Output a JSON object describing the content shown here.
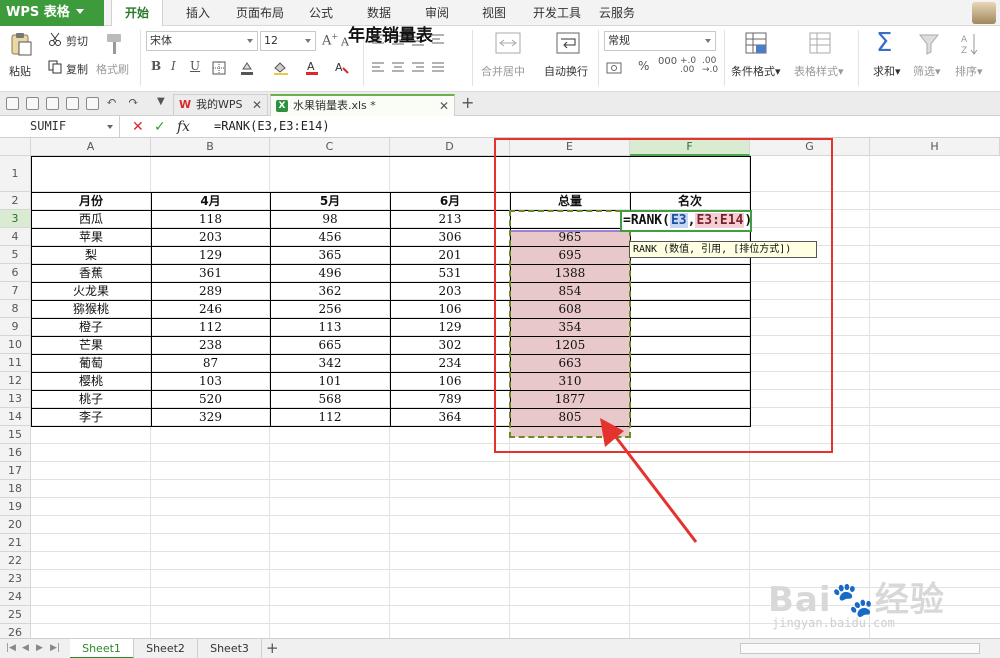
{
  "app": {
    "brand": "WPS 表格",
    "brand_color": "#3d9b3c",
    "accent_color": "#2a8a2a"
  },
  "menu": {
    "tabs": [
      "开始",
      "插入",
      "页面布局",
      "公式",
      "数据",
      "审阅",
      "视图",
      "开发工具",
      "云服务"
    ],
    "active": "开始"
  },
  "ribbon": {
    "paste": "粘贴",
    "cut": "剪切",
    "copy": "复制",
    "format_painter": "格式刷",
    "font_name": "宋体",
    "font_size": "12",
    "bold": "B",
    "italic": "I",
    "underline": "U",
    "merge_center": "合并居中",
    "wrap_text": "自动换行",
    "number_format": "常规",
    "percent": "%",
    "conditional_format": "条件格式",
    "table_style": "表格样式",
    "sum": "求和",
    "filter": "筛选",
    "sort": "排序"
  },
  "doc_tabs": [
    {
      "label": "我的WPS",
      "icon": "W"
    },
    {
      "label": "水果销量表.xls *",
      "icon": "X"
    }
  ],
  "formula_bar": {
    "name_box": "SUMIF",
    "formula": "=RANK(E3,E3:E14)"
  },
  "columns": [
    "A",
    "B",
    "C",
    "D",
    "E",
    "F",
    "G",
    "H"
  ],
  "selected_column": "F",
  "rows": [
    "1",
    "2",
    "3",
    "4",
    "5",
    "6",
    "7",
    "8",
    "9",
    "10",
    "11",
    "12",
    "13",
    "14",
    "15",
    "16",
    "17",
    "18",
    "19",
    "20",
    "21",
    "22",
    "23",
    "24",
    "25",
    "26"
  ],
  "selected_row": "3",
  "table": {
    "title": "年度销量表",
    "headers": [
      "月份",
      "4月",
      "5月",
      "6月",
      "总量",
      "名次"
    ],
    "records": [
      [
        "西瓜",
        "118",
        "98",
        "213",
        ""
      ],
      [
        "苹果",
        "203",
        "456",
        "306",
        "965"
      ],
      [
        "梨",
        "129",
        "365",
        "201",
        "695"
      ],
      [
        "香蕉",
        "361",
        "496",
        "531",
        "1388"
      ],
      [
        "火龙果",
        "289",
        "362",
        "203",
        "854"
      ],
      [
        "猕猴桃",
        "246",
        "256",
        "106",
        "608"
      ],
      [
        "橙子",
        "112",
        "113",
        "129",
        "354"
      ],
      [
        "芒果",
        "238",
        "665",
        "302",
        "1205"
      ],
      [
        "葡萄",
        "87",
        "342",
        "234",
        "663"
      ],
      [
        "樱桃",
        "103",
        "101",
        "106",
        "310"
      ],
      [
        "桃子",
        "520",
        "568",
        "789",
        "1877"
      ],
      [
        "李子",
        "329",
        "112",
        "364",
        "805"
      ]
    ]
  },
  "editing": {
    "prefix": "=RANK(",
    "ref1": "E3",
    "sep": ",",
    "ref2": "E3:E14",
    "suffix": ")"
  },
  "tooltip": "RANK (数值, 引用, [排位方式])",
  "sheets": [
    "Sheet1",
    "Sheet2",
    "Sheet3"
  ],
  "active_sheet": "Sheet1",
  "watermark": {
    "logo": "Bai🐾经验",
    "url": "jingyan.baidu.com"
  },
  "annotation_color": "#e4332f"
}
